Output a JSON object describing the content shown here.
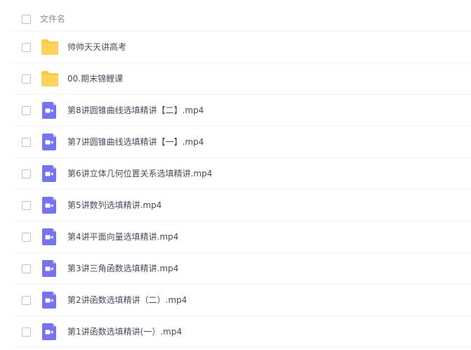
{
  "header": {
    "column_label": "文件名"
  },
  "files": [
    {
      "name": "帅帅天天讲高考",
      "type": "folder-icon"
    },
    {
      "name": "00.期末锦鲤课",
      "type": "folder-icon"
    },
    {
      "name": "第8讲圆锥曲线选填精讲【二】.mp4",
      "type": "video-icon"
    },
    {
      "name": "第7讲圆锥曲线选填精讲【一】.mp4",
      "type": "video-icon"
    },
    {
      "name": "第6讲立体几何位置关系选填精讲.mp4",
      "type": "video-icon"
    },
    {
      "name": "第5讲数列选填精讲.mp4",
      "type": "video-icon"
    },
    {
      "name": "第4讲平面向量选填精讲.mp4",
      "type": "video-icon"
    },
    {
      "name": "第3讲三角函数选填精讲.mp4",
      "type": "video-icon"
    },
    {
      "name": "第2讲函数选填精讲（二）.mp4",
      "type": "video-icon"
    },
    {
      "name": "第1讲函数选填精讲(一）.mp4",
      "type": "video-icon"
    }
  ],
  "colors": {
    "folder": "#fcc94a",
    "video": "#7773ec"
  }
}
